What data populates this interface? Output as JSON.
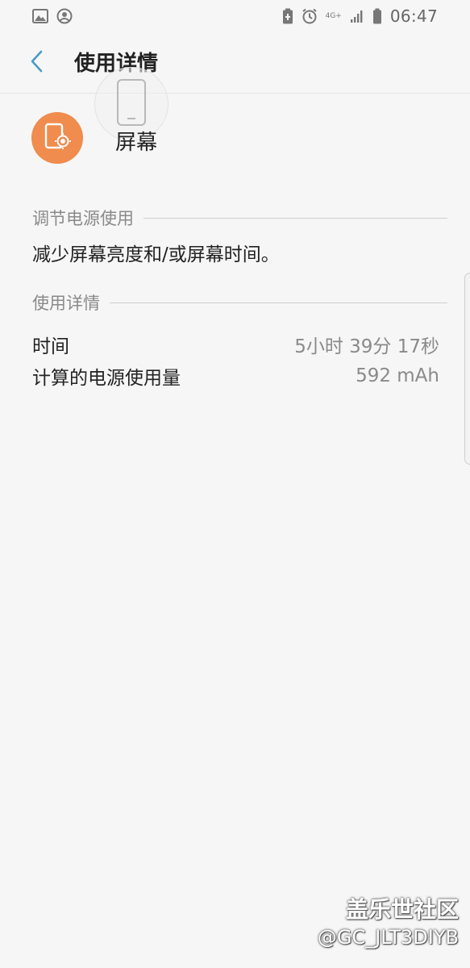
{
  "status_bar": {
    "time": "06:47",
    "network_type": "4G+",
    "icons": [
      "image-icon",
      "account-circle-icon",
      "battery-saver-icon",
      "alarm-icon",
      "signal-icon",
      "battery-icon"
    ]
  },
  "header": {
    "title": "使用详情",
    "back_icon": "chevron-left-icon"
  },
  "app": {
    "name": "屏幕",
    "icon": "screen-brightness-icon",
    "icon_color": "#ef8c4e"
  },
  "adjust_section": {
    "title": "调节电源使用",
    "tip": "减少屏幕亮度和/或屏幕时间。"
  },
  "usage_section": {
    "title": "使用详情",
    "rows": [
      {
        "label": "时间",
        "value": "5小时 39分 17秒"
      },
      {
        "label": "计算的电源使用量",
        "value": "592 mAh"
      }
    ]
  },
  "watermark": {
    "main": "盖乐世社区",
    "sub": "@GC_JLT3DIYB"
  },
  "colors": {
    "accent": "#4a9bc4",
    "background": "#f6f6f6",
    "secondary_text": "#8a8a8a"
  }
}
